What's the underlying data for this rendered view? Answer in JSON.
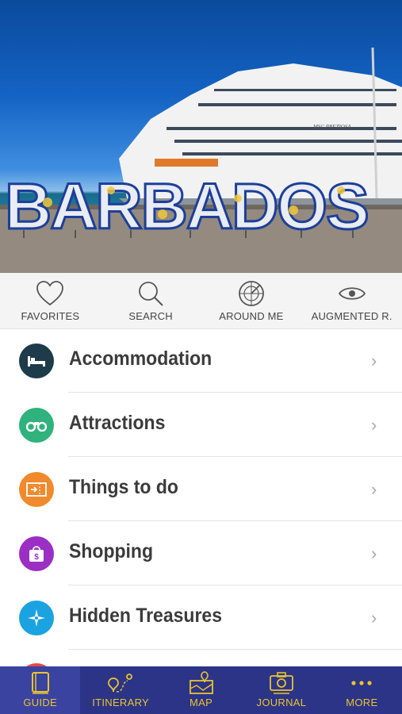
{
  "hero": {
    "sign_text": "BARBADOS",
    "ship_name": "MSC PREZIOSA"
  },
  "quick_actions": [
    {
      "label": "FAVORITES",
      "icon": "heart-icon"
    },
    {
      "label": "SEARCH",
      "icon": "search-icon"
    },
    {
      "label": "AROUND ME",
      "icon": "radar-icon"
    },
    {
      "label": "AUGMENTED R.",
      "icon": "eye-icon"
    }
  ],
  "menu": [
    {
      "label": "Accommodation",
      "icon": "bed-icon",
      "color": "#1d3b4a"
    },
    {
      "label": "Attractions",
      "icon": "binoculars-icon",
      "color": "#2fb27c"
    },
    {
      "label": "Things to do",
      "icon": "ticket-icon",
      "color": "#f08a2c"
    },
    {
      "label": "Shopping",
      "icon": "shopping-bag-icon",
      "color": "#9b2fc4"
    },
    {
      "label": "Hidden Treasures",
      "icon": "compass-icon",
      "color": "#1aa3e0"
    }
  ],
  "tabs": [
    {
      "label": "GUIDE",
      "icon": "book-icon",
      "active": true
    },
    {
      "label": "ITINERARY",
      "icon": "route-icon",
      "active": false
    },
    {
      "label": "MAP",
      "icon": "map-icon",
      "active": false
    },
    {
      "label": "JOURNAL",
      "icon": "camera-icon",
      "active": false
    },
    {
      "label": "MORE",
      "icon": "more-dots-icon",
      "active": false
    }
  ],
  "colors": {
    "tabbar_bg": "#2c3487",
    "tab_accent": "#e8c430",
    "chevron": "#aaaaaa"
  }
}
